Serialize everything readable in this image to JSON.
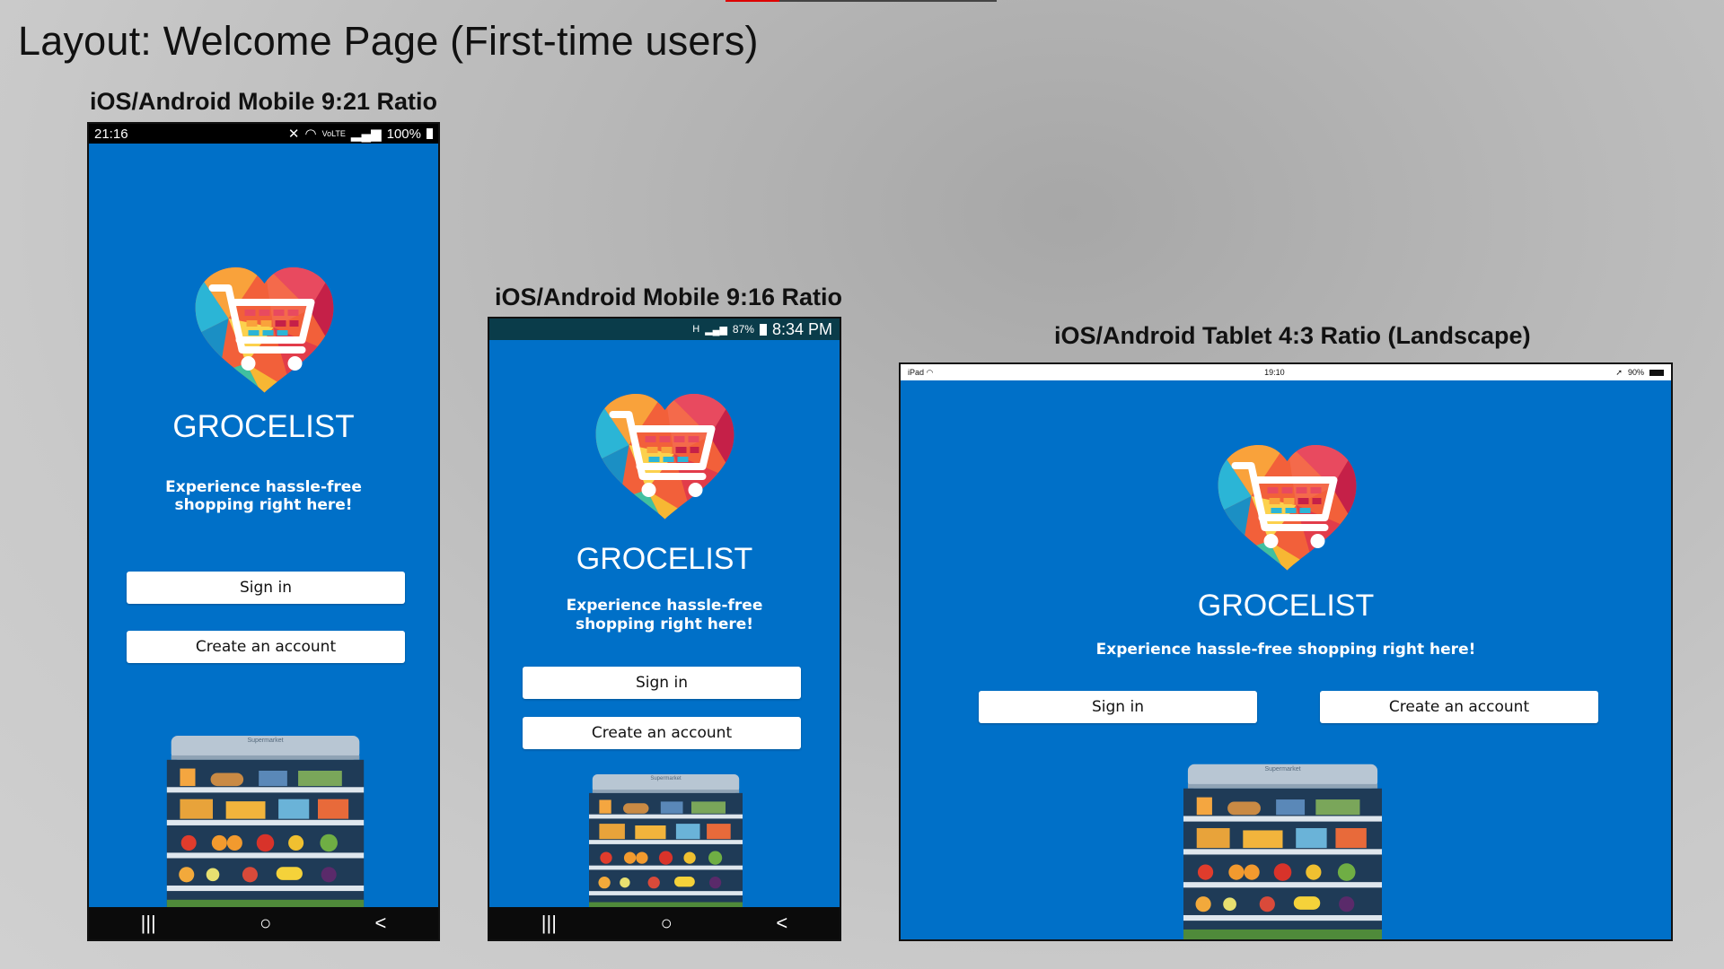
{
  "slide": {
    "title": "Layout: Welcome Page (First-time users)"
  },
  "labels": {
    "mobile_921": "iOS/Android Mobile 9:21 Ratio",
    "mobile_916": "iOS/Android Mobile 9:16 Ratio",
    "tablet_43": "iOS/Android Tablet 4:3 Ratio (Landscape)"
  },
  "app": {
    "name": "GROCELIST",
    "tagline_line1": "Experience hassle-free",
    "tagline_line2": "shopping right here!",
    "tagline_full": "Experience hassle-free shopping right here!",
    "sign_in": "Sign in",
    "create_account": "Create an account",
    "store_sign": "Supermarket",
    "background_color": "#0070c8"
  },
  "status_921": {
    "time": "21:16",
    "network": "VoLTE",
    "battery": "100%"
  },
  "status_916": {
    "network": "H",
    "battery": "87%",
    "time": "8:34 PM"
  },
  "status_tablet": {
    "device": "iPad",
    "time": "19:10",
    "battery": "90%"
  },
  "navbar": {
    "recents_icon": "|||",
    "home_icon": "○",
    "back_icon": "<"
  }
}
